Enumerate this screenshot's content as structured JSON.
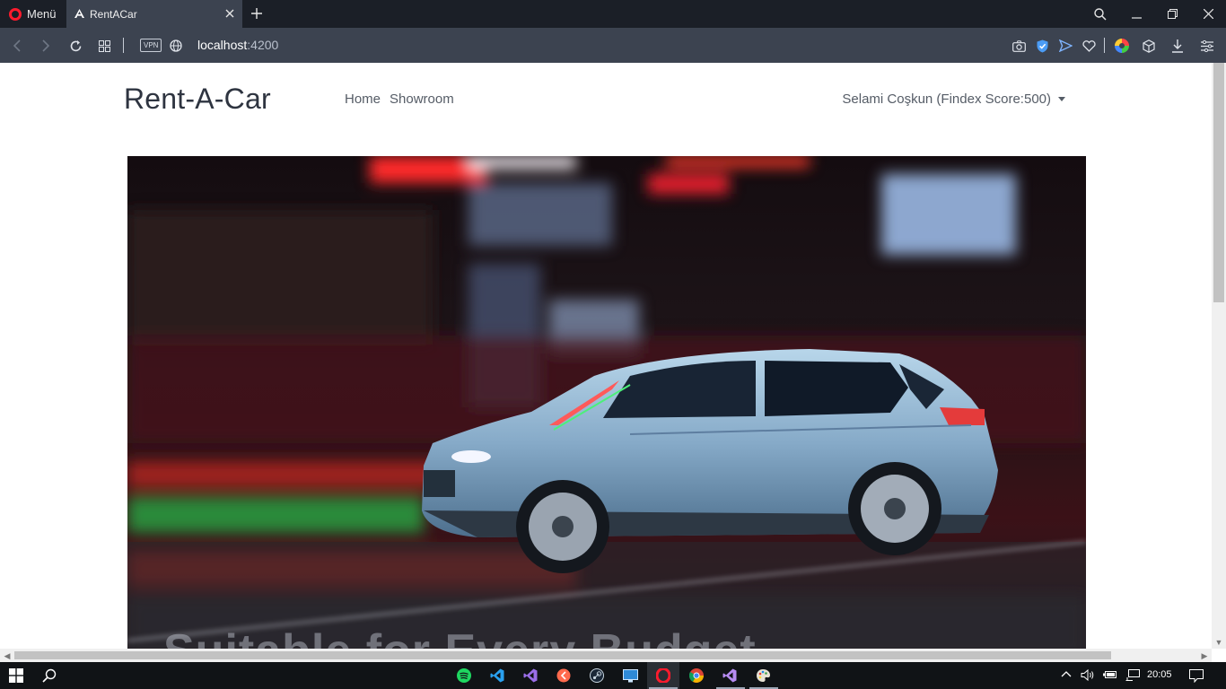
{
  "browser": {
    "menu_label": "Menü",
    "tab_title": "RentACar",
    "address": {
      "host": "localhost",
      "port": ":4200"
    },
    "vpn_label": "VPN"
  },
  "page": {
    "brand": "Rent-A-Car",
    "nav": [
      "Home",
      "Showroom"
    ],
    "user_menu": "Selami Coşkun (Findex Score:500)",
    "hero_caption": "Suitable for Every Budget"
  },
  "taskbar": {
    "time": "20:05",
    "apps": [
      "spotify-icon",
      "vscode-icon",
      "visual-studio-icon",
      "git-client-icon",
      "steam-icon",
      "remote-desktop-icon",
      "opera-icon",
      "chrome-icon",
      "visual-studio-icon",
      "paint-icon"
    ]
  },
  "colors": {
    "tabstrip": "#1b1f27",
    "addressbar": "#3c4350",
    "opera_red": "#ff1b2d",
    "brand_text": "#2e3440"
  }
}
